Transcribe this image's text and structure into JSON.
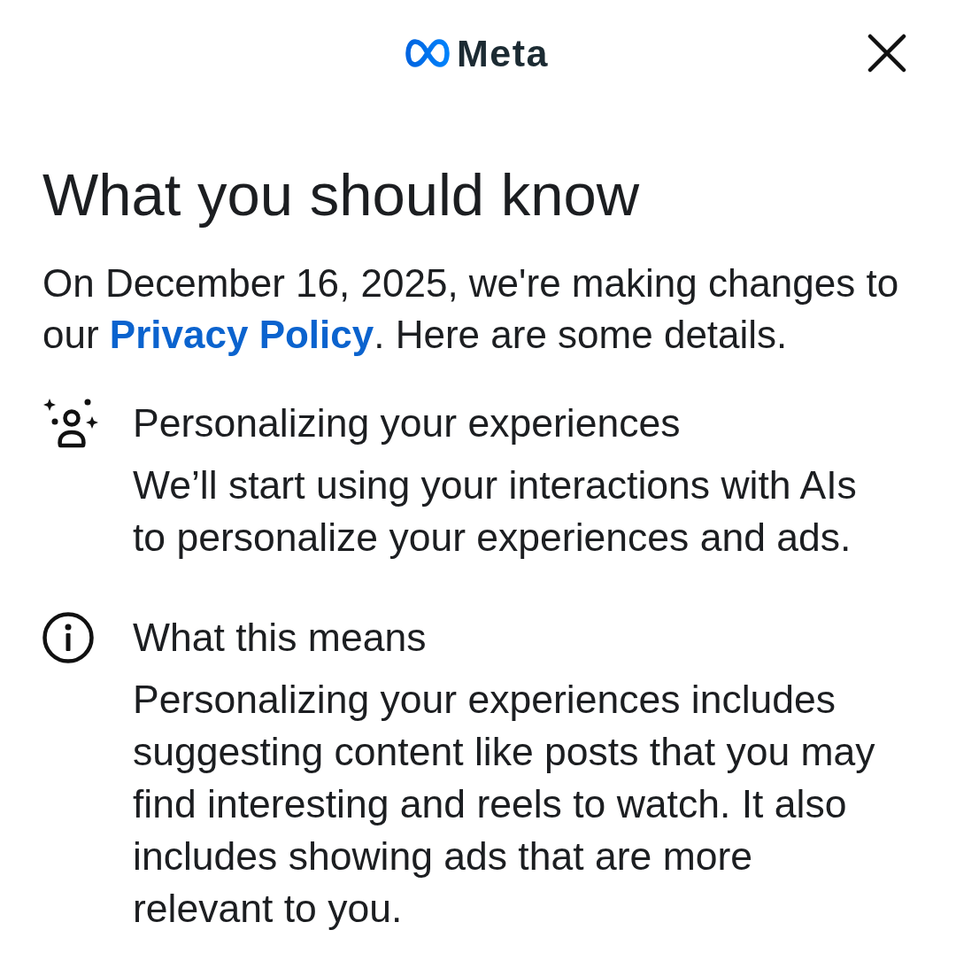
{
  "header": {
    "logo_text": "Meta"
  },
  "title": "What you should know",
  "intro": {
    "before": "On December 16, 2025, we're making changes to our ",
    "link": "Privacy Policy",
    "after": ". Here are some details."
  },
  "items": [
    {
      "kind": "personalize",
      "title": "Personalizing your experiences",
      "body": "We’ll start using your interactions with AIs to personalize your experiences and ads."
    },
    {
      "kind": "info",
      "title": "What this means",
      "body": "Personalizing your experiences includes suggesting content like posts that you may find interesting and reels to watch. It also includes showing ads that are more relevant to you."
    }
  ]
}
